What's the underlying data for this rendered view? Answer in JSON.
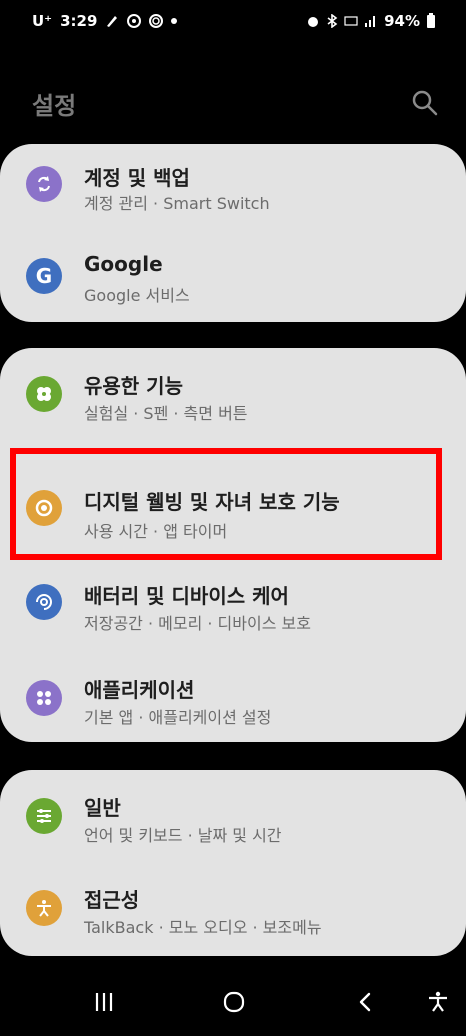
{
  "status_bar": {
    "carrier": "U⁺",
    "time": "3:29",
    "battery": "94%"
  },
  "header": {
    "title": "설정",
    "search_icon": "search-icon"
  },
  "groups": [
    {
      "items": [
        {
          "title": "계정 및 백업",
          "subtitle": "계정 관리 · Smart Switch",
          "icon": "sync-icon",
          "color": "#8b72c9"
        },
        {
          "title": "Google",
          "subtitle": "Google 서비스",
          "icon": "google-icon",
          "color": "#3f6fbf"
        }
      ]
    },
    {
      "items": [
        {
          "title": "유용한 기능",
          "subtitle": "실험실 · S펜 · 측면 버튼",
          "icon": "puzzle-icon",
          "color": "#6aa832"
        },
        {
          "title": "디지털 웰빙 및 자녀 보호 기능",
          "subtitle": "사용 시간 · 앱 타이머",
          "icon": "wellbeing-icon",
          "color": "#e0a13a"
        },
        {
          "title": "배터리 및 디바이스 케어",
          "subtitle": "저장공간 · 메모리 · 디바이스 보호",
          "icon": "device-care-icon",
          "color": "#3f6fbf"
        },
        {
          "title": "애플리케이션",
          "subtitle": "기본 앱 · 애플리케이션 설정",
          "icon": "apps-icon",
          "color": "#8b72c9"
        }
      ]
    },
    {
      "items": [
        {
          "title": "일반",
          "subtitle": "언어 및 키보드 · 날짜 및 시간",
          "icon": "sliders-icon",
          "color": "#6aa832"
        },
        {
          "title": "접근성",
          "subtitle": "TalkBack · 모노 오디오 · 보조메뉴",
          "icon": "accessibility-icon",
          "color": "#e0a13a"
        }
      ]
    }
  ],
  "navbar": {
    "recent": "recent-apps-icon",
    "home": "home-icon",
    "back": "back-icon",
    "accessibility": "accessibility-shortcut-icon"
  }
}
